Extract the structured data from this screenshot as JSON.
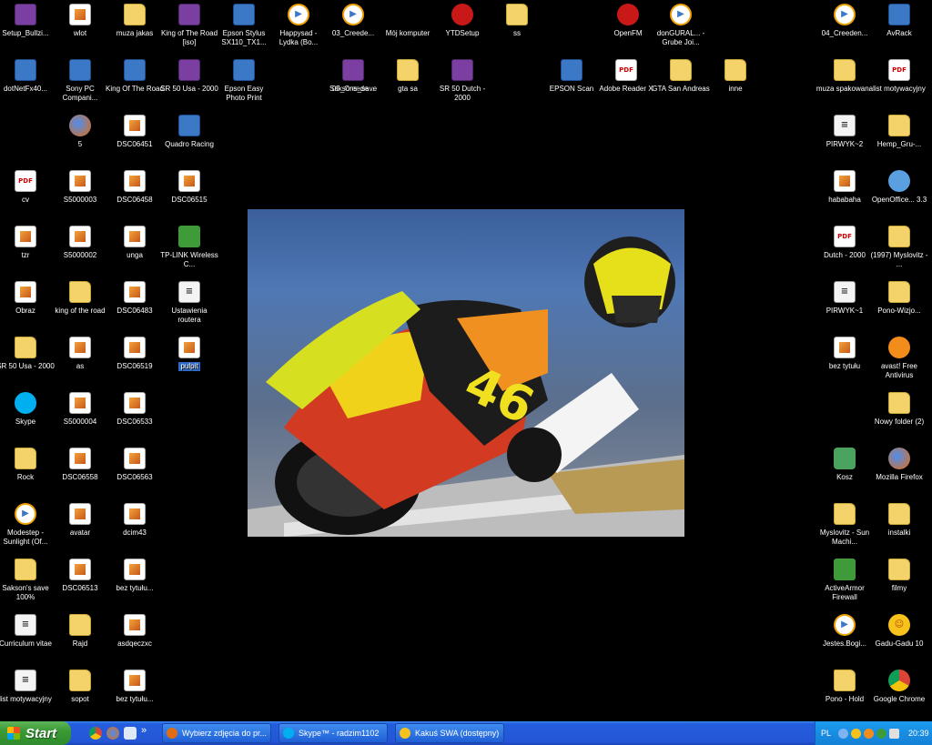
{
  "desktop": {
    "icons": [
      {
        "label": "Setup_Bullzi...",
        "type": "rar"
      },
      {
        "label": "wlot",
        "type": "image"
      },
      {
        "label": "muza jakas",
        "type": "folder"
      },
      {
        "label": "King of The Road [iso]",
        "type": "rar"
      },
      {
        "label": "Epson Stylus SX110_TX1...",
        "type": "exe"
      },
      {
        "label": "Happysad - Lydka (Bo...",
        "type": "media"
      },
      {
        "label": "03_Creede...",
        "type": "media"
      },
      {
        "label": "Mój komputer",
        "type": "computer"
      },
      {
        "label": "YTDSetup",
        "type": "red"
      },
      {
        "label": "ss",
        "type": "folder"
      },
      {
        "label": "OpenFM",
        "type": "red"
      },
      {
        "label": "donGURAL... - Grube Joi...",
        "type": "media"
      },
      {
        "label": "04_Creeden...",
        "type": "media"
      },
      {
        "label": "AvRack",
        "type": "exe"
      },
      {
        "label": "dotNetFx40...",
        "type": "exe"
      },
      {
        "label": "Sony PC Compani...",
        "type": "exe"
      },
      {
        "label": "King Of The Road",
        "type": "exe"
      },
      {
        "label": "SR 50 Usa - 2000",
        "type": "rar"
      },
      {
        "label": "Epson Easy Photo Print",
        "type": "exe"
      },
      {
        "label": "05_Creede...",
        "type": "media"
      },
      {
        "label": "Saksons_save",
        "type": "rar"
      },
      {
        "label": "gta sa",
        "type": "folder"
      },
      {
        "label": "SR 50 Dutch - 2000",
        "type": "rar"
      },
      {
        "label": "EPSON Scan",
        "type": "exe"
      },
      {
        "label": "Adobe Reader X",
        "type": "pdf"
      },
      {
        "label": "GTA San Andreas",
        "type": "folder"
      },
      {
        "label": "inne",
        "type": "folder"
      },
      {
        "label": "muza spakowana",
        "type": "folder"
      },
      {
        "label": "list motywacyjny",
        "type": "pdf"
      },
      {
        "label": "5",
        "type": "ff"
      },
      {
        "label": "DSC06451",
        "type": "image"
      },
      {
        "label": "Quadro Racing",
        "type": "exe"
      },
      {
        "label": "PIRWYK~2",
        "type": "doc"
      },
      {
        "label": "Hemp_Gru-...",
        "type": "folder"
      },
      {
        "label": "cv",
        "type": "pdf"
      },
      {
        "label": "S5000003",
        "type": "image"
      },
      {
        "label": "DSC06458",
        "type": "image"
      },
      {
        "label": "DSC06515",
        "type": "image"
      },
      {
        "label": "hababaha",
        "type": "image"
      },
      {
        "label": "OpenOffice... 3.3",
        "type": "oo"
      },
      {
        "label": "tzr",
        "type": "image"
      },
      {
        "label": "S5000002",
        "type": "image"
      },
      {
        "label": "unga",
        "type": "image"
      },
      {
        "label": "TP-LINK Wireless C...",
        "type": "green"
      },
      {
        "label": "Dutch - 2000",
        "type": "pdf"
      },
      {
        "label": "(1997) Myslovitz - ...",
        "type": "folder"
      },
      {
        "label": "Obraz",
        "type": "image"
      },
      {
        "label": "king of the road",
        "type": "folder"
      },
      {
        "label": "DSC06483",
        "type": "image"
      },
      {
        "label": "Ustawienia routera",
        "type": "doc"
      },
      {
        "label": "PIRWYK~1",
        "type": "doc"
      },
      {
        "label": "Pono-Wizjo...",
        "type": "folder"
      },
      {
        "label": "SR 50 Usa - 2000",
        "type": "folder"
      },
      {
        "label": "as",
        "type": "image"
      },
      {
        "label": "DSC06519",
        "type": "image"
      },
      {
        "label": "pulpit",
        "type": "image",
        "selected": true
      },
      {
        "label": "bez tytułu",
        "type": "image"
      },
      {
        "label": "avast! Free Antivirus",
        "type": "avast"
      },
      {
        "label": "Skype",
        "type": "skype"
      },
      {
        "label": "S5000004",
        "type": "image"
      },
      {
        "label": "DSC06533",
        "type": "image"
      },
      {
        "label": "Nowy folder (2)",
        "type": "folder"
      },
      {
        "label": "Rock",
        "type": "folder"
      },
      {
        "label": "DSC06558",
        "type": "image"
      },
      {
        "label": "DSC06563",
        "type": "image"
      },
      {
        "label": "Kosz",
        "type": "recycle"
      },
      {
        "label": "Mozilla Firefox",
        "type": "ff"
      },
      {
        "label": "Modestep - Sunlight (Of...",
        "type": "media"
      },
      {
        "label": "avatar",
        "type": "image"
      },
      {
        "label": "dcim43",
        "type": "image"
      },
      {
        "label": "Myslovitz - Sun Machi...",
        "type": "folder"
      },
      {
        "label": "instalki",
        "type": "folder"
      },
      {
        "label": "Sakson's save 100%",
        "type": "folder"
      },
      {
        "label": "DSC06513",
        "type": "image"
      },
      {
        "label": "bez tytułu...",
        "type": "image"
      },
      {
        "label": "ActiveArmor Firewall",
        "type": "green"
      },
      {
        "label": "filmy",
        "type": "folder"
      },
      {
        "label": "Curriculum vitae",
        "type": "doc"
      },
      {
        "label": "Rajd",
        "type": "folder"
      },
      {
        "label": "asdqeczxc",
        "type": "image"
      },
      {
        "label": "Jestes.Bogi...",
        "type": "media"
      },
      {
        "label": "Gadu-Gadu 10",
        "type": "sun"
      },
      {
        "label": "list motywacyjny",
        "type": "doc"
      },
      {
        "label": "sopot",
        "type": "folder"
      },
      {
        "label": "bez tytułu...",
        "type": "image"
      },
      {
        "label": "Pono - Hold",
        "type": "folder"
      },
      {
        "label": "Google Chrome",
        "type": "chrome"
      }
    ]
  },
  "taskbar": {
    "start_label": "Start",
    "quick_more": "»",
    "tasks": [
      {
        "label": "Wybierz zdjęcia do pr...",
        "color": "#e26c13"
      },
      {
        "label": "Skype™ - radzim1102",
        "color": "#00aff0"
      },
      {
        "label": "Kakuś SWA (dostępny)",
        "color": "#f7c21b"
      }
    ],
    "tray": {
      "language": "PL",
      "clock": "20:39"
    }
  }
}
